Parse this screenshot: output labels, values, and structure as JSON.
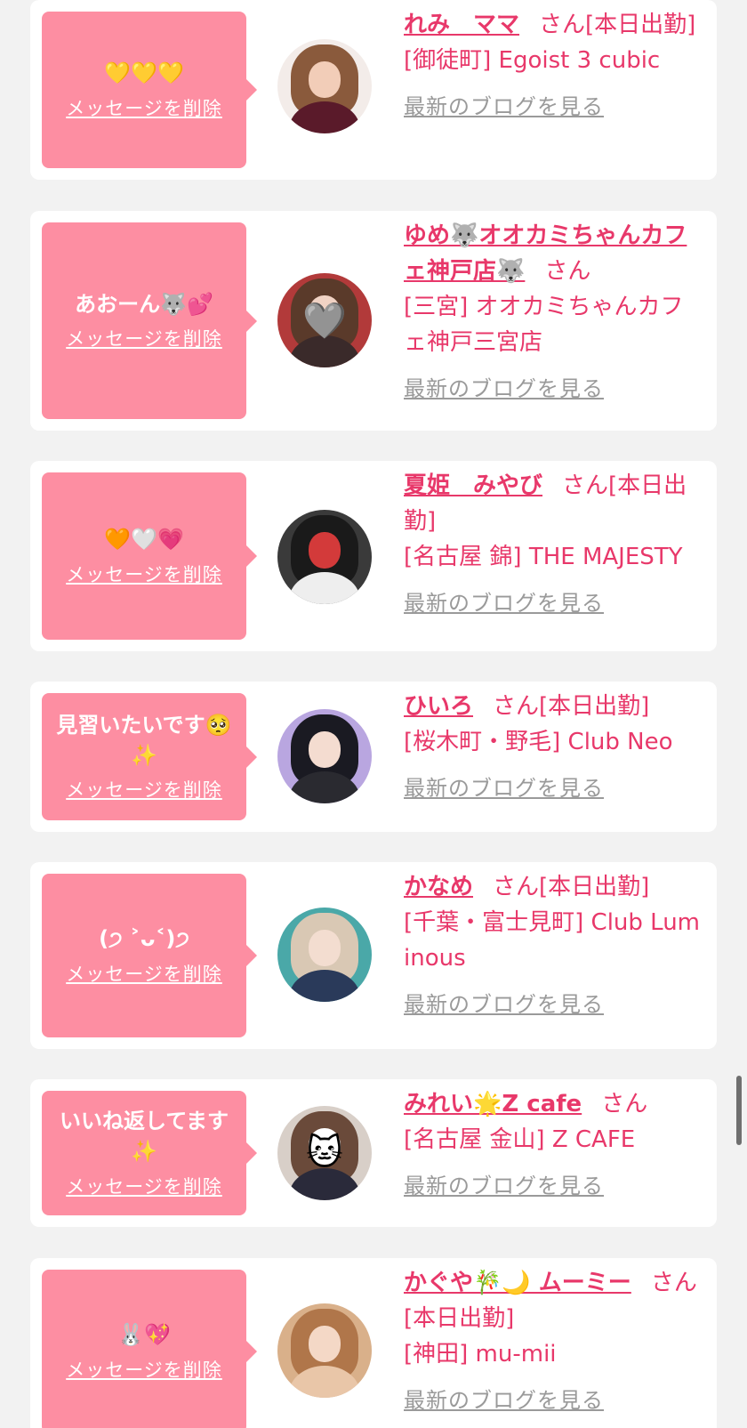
{
  "cards": [
    {
      "message": "💛💛💛",
      "delete_label": "メッセージを削除",
      "name": "れみ　ママ",
      "honorific": "さん",
      "status": "[本日出勤]",
      "shop": "[御徒町] Egoist 3 cubic",
      "blog_label": "最新のブログを見る"
    },
    {
      "message": "あおーん🐺💕",
      "delete_label": "メッセージを削除",
      "name": "ゆめ🐺オオカミちゃんカフェ神戸店🐺",
      "honorific": "さん",
      "status": "",
      "shop": "[三宮] オオカミちゃんカフェ神戸三宮店",
      "blog_label": "最新のブログを見る"
    },
    {
      "message": "🧡🤍💗",
      "delete_label": "メッセージを削除",
      "name": "夏姫　みやび",
      "honorific": "さん",
      "status": "[本日出勤]",
      "shop": "[名古屋 錦] THE MAJESTY",
      "blog_label": "最新のブログを見る"
    },
    {
      "message": "見習いたいです🥺✨",
      "delete_label": "メッセージを削除",
      "name": "ひいろ",
      "honorific": "さん",
      "status": "[本日出勤]",
      "shop": "[桜木町・野毛] Club Neo",
      "blog_label": "最新のブログを見る"
    },
    {
      "message": "(੭ ˃ᴗ˂)੭",
      "delete_label": "メッセージを削除",
      "name": "かなめ",
      "honorific": "さん",
      "status": "[本日出勤]",
      "shop": "[千葉・富士見町] Club Luminous",
      "blog_label": "最新のブログを見る"
    },
    {
      "message": "いいね返してます✨",
      "delete_label": "メッセージを削除",
      "name": "みれい🌟Z cafe",
      "honorific": "さん",
      "status": "",
      "shop": "[名古屋 金山] Z CAFE",
      "blog_label": "最新のブログを見る"
    },
    {
      "message": "🐰💖",
      "delete_label": "メッセージを削除",
      "name": "かぐや🎋🌙 ムーミー",
      "honorific": "さん",
      "status": "[本日出勤]",
      "shop": "[神田] mu-mii",
      "blog_label": "最新のブログを見る"
    }
  ]
}
